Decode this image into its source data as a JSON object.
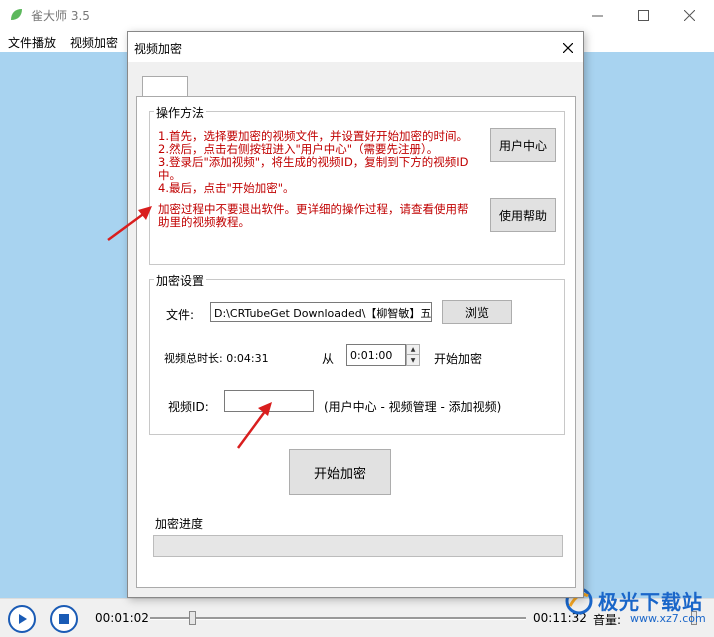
{
  "app": {
    "title": "雀大师 3.5",
    "menu": [
      "文件播放",
      "视频加密"
    ]
  },
  "player": {
    "current_time": "00:01:02",
    "total_time": "00:11:32",
    "volume_label": "音量:",
    "progress": 0.11
  },
  "watermark": {
    "text": "极光下载站",
    "url": "www.xz7.com"
  },
  "dialog": {
    "title": "视频加密",
    "instructions_group": {
      "legend": "操作方法",
      "lines": [
        "1.首先，选择要加密的视频文件，并设置好开始加密的时间。",
        "2.然后，点击右侧按钮进入\"用户中心\"（需要先注册）。",
        "3.登录后\"添加视频\"，将生成的视频ID，复制到下方的视频ID中。",
        "4.最后，点击\"开始加密\"。"
      ],
      "note": "加密过程中不要退出软件。更详细的操作过程，请查看使用帮助里的视频教程。",
      "user_center_button": "用户中心",
      "help_button": "使用帮助"
    },
    "settings_group": {
      "legend": "加密设置",
      "file_label": "文件:",
      "file_path": "D:\\CRTubeGet Downloaded\\【柳智敏】五转",
      "browse_button": "浏览",
      "duration_label": "视频总时长: 0:04:31",
      "from_label": "从",
      "start_time": "0:01:00",
      "start_encrypt_label": "开始加密",
      "video_id_label": "视频ID:",
      "video_id_value": "",
      "video_id_hint": "(用户中心 - 视频管理 - 添加视频)"
    },
    "start_button": "开始加密",
    "progress_label": "加密进度",
    "progress_value": 0
  }
}
